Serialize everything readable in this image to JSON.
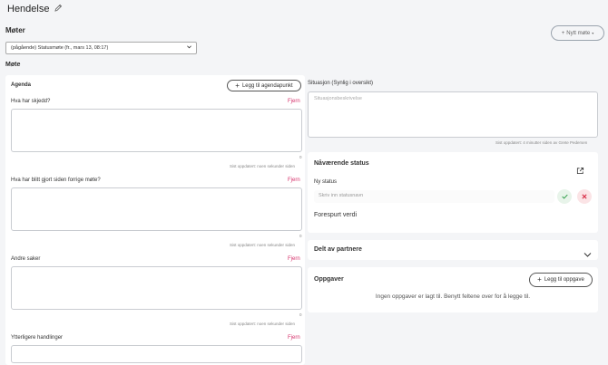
{
  "header": {
    "title": "Hendelse",
    "edit_icon": "pencil-icon"
  },
  "meetings": {
    "heading": "Møter",
    "new_meeting_label": "Nytt møte",
    "selected": "(pågående) Statusmøte (fr., mars 13, 08:17)"
  },
  "meeting": {
    "heading": "Møte",
    "agenda": {
      "title": "Agenda",
      "add_label": "Legg til agendapunkt",
      "items": [
        {
          "label": "Hva har skjedd?",
          "remove": "Fjern",
          "count": "0",
          "updated": "Sist oppdatert: noen sekunder siden"
        },
        {
          "label": "Hva har blitt gjort siden forrige møte?",
          "remove": "Fjern",
          "count": "0",
          "updated": "Sist oppdatert: noen sekunder siden"
        },
        {
          "label": "Andre saker",
          "remove": "Fjern",
          "count": "0",
          "updated": "Sist oppdatert: noen sekunder siden"
        },
        {
          "label": "Ytterligere handlinger",
          "remove": "Fjern"
        }
      ]
    },
    "situation": {
      "label": "Situasjon (Synlig i oversikt)",
      "placeholder": "Situasjonsbeskrivelse",
      "updated": "Sist oppdatert: 4 minutter siden  av Grete Pedersen"
    },
    "status": {
      "title": "Nåværende status",
      "new_status_label": "Ny status",
      "input_placeholder": "Skriv inn statusnavn",
      "requested_label": "Forespurt verdi",
      "colors": {
        "confirm": "#2e9d47",
        "cancel": "#d9324a"
      }
    },
    "shared": {
      "title": "Delt av partnere"
    },
    "tasks": {
      "title": "Oppgaver",
      "add_label": "Legg til oppgave",
      "empty_text": "Ingen oppgaver er lagt til. Benytt feltene over for å legge til."
    }
  }
}
